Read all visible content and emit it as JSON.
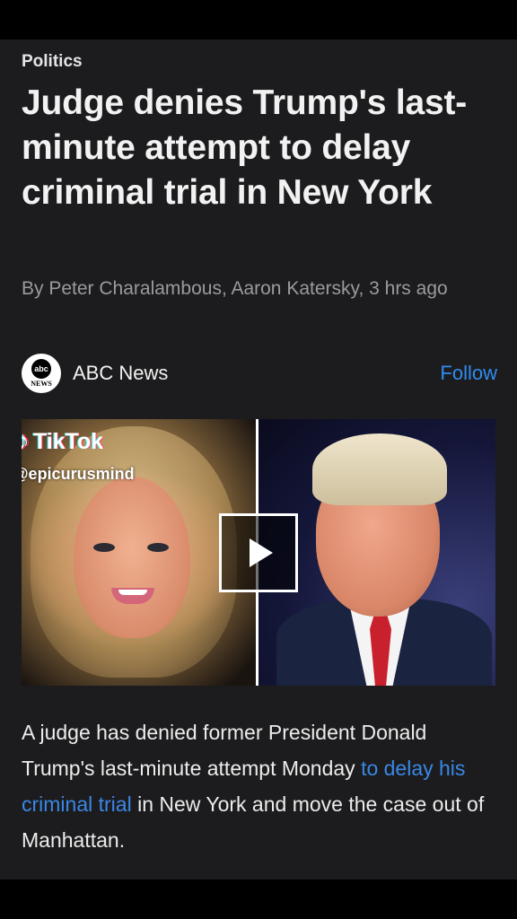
{
  "article": {
    "category": "Politics",
    "headline": "Judge denies Trump's last-minute attempt to delay criminal trial in New York",
    "byline": "By Peter Charalambous, Aaron Katersky, 3 hrs ago"
  },
  "source": {
    "logo_top": "abc",
    "logo_bottom": "NEWS",
    "name": "ABC News",
    "follow_label": "Follow"
  },
  "media": {
    "tiktok_label": "TikTok",
    "tiktok_handle": "@epicurusmind",
    "play_icon": "play-icon"
  },
  "body": {
    "text_before": "A judge has denied former President Donald Trump's last-minute attempt Monday ",
    "link_text": "to delay his criminal trial",
    "text_after": " in New York and move the case out of Manhattan."
  },
  "colors": {
    "background": "#1c1c1e",
    "accent": "#2f8cf0",
    "link": "#3a87e6"
  }
}
